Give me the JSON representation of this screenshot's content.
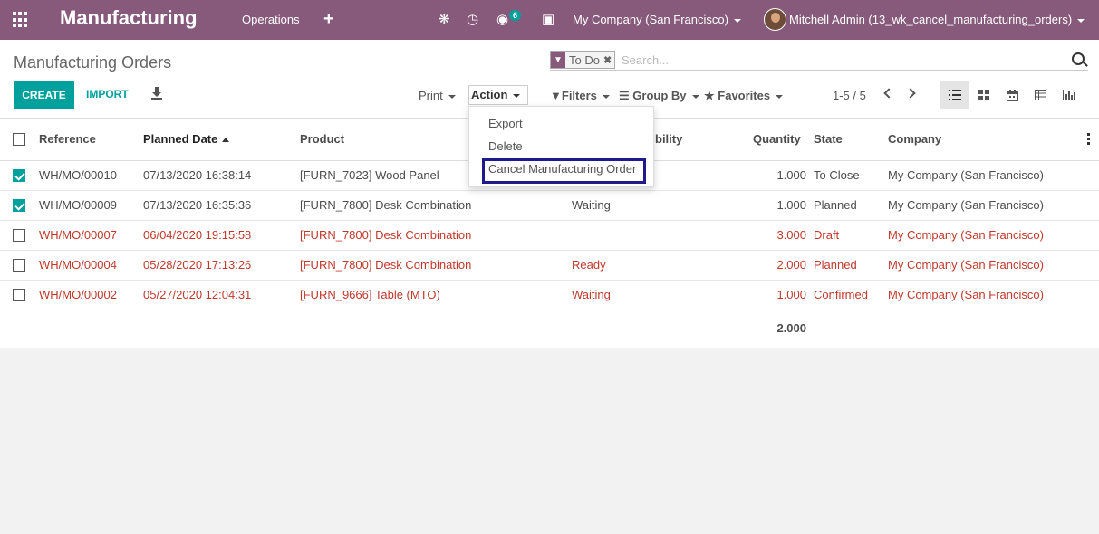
{
  "topbar": {
    "app_title": "Manufacturing",
    "menu_operations": "Operations",
    "messages_badge": "6",
    "company": "My Company (San Francisco)",
    "user": "Mitchell Admin (13_wk_cancel_manufacturing_orders)",
    "bg_color": "#875a7b"
  },
  "control_panel": {
    "title": "Manufacturing Orders",
    "search_facet": "To Do",
    "search_placeholder": "Search...",
    "create_label": "CREATE",
    "import_label": "IMPORT",
    "print_label": "Print",
    "action_label": "Action",
    "filters_label": "Filters",
    "groupby_label": "Group By",
    "favorites_label": "Favorites",
    "pager": "1-5 / 5",
    "accent_color": "#00a09d"
  },
  "action_menu": {
    "items": [
      "Export",
      "Delete",
      "Cancel Manufacturing Order"
    ]
  },
  "table": {
    "headers": {
      "reference": "Reference",
      "planned_date": "Planned Date",
      "product": "Product",
      "availability": "Material Availability",
      "availability_visible": "bility",
      "quantity": "Quantity",
      "state": "State",
      "company": "Company"
    },
    "rows": [
      {
        "checked": true,
        "late": false,
        "reference": "WH/MO/00010",
        "date": "07/13/2020 16:38:14",
        "product": "[FURN_7023] Wood Panel",
        "availability": "",
        "quantity": "1.000",
        "state": "To Close",
        "company": "My Company (San Francisco)"
      },
      {
        "checked": true,
        "late": false,
        "reference": "WH/MO/00009",
        "date": "07/13/2020 16:35:36",
        "product": "[FURN_7800] Desk Combination",
        "availability": "Waiting",
        "quantity": "1.000",
        "state": "Planned",
        "company": "My Company (San Francisco)"
      },
      {
        "checked": false,
        "late": true,
        "reference": "WH/MO/00007",
        "date": "06/04/2020 19:15:58",
        "product": "[FURN_7800] Desk Combination",
        "availability": "",
        "quantity": "3.000",
        "state": "Draft",
        "company": "My Company (San Francisco)"
      },
      {
        "checked": false,
        "late": true,
        "reference": "WH/MO/00004",
        "date": "05/28/2020 17:13:26",
        "product": "[FURN_7800] Desk Combination",
        "availability": "Ready",
        "quantity": "2.000",
        "state": "Planned",
        "company": "My Company (San Francisco)"
      },
      {
        "checked": false,
        "late": true,
        "reference": "WH/MO/00002",
        "date": "05/27/2020 12:04:31",
        "product": "[FURN_9666] Table (MTO)",
        "availability": "Waiting",
        "quantity": "1.000",
        "state": "Confirmed",
        "company": "My Company (San Francisco)"
      }
    ],
    "total_quantity": "2.000",
    "late_color": "#c0392b"
  }
}
